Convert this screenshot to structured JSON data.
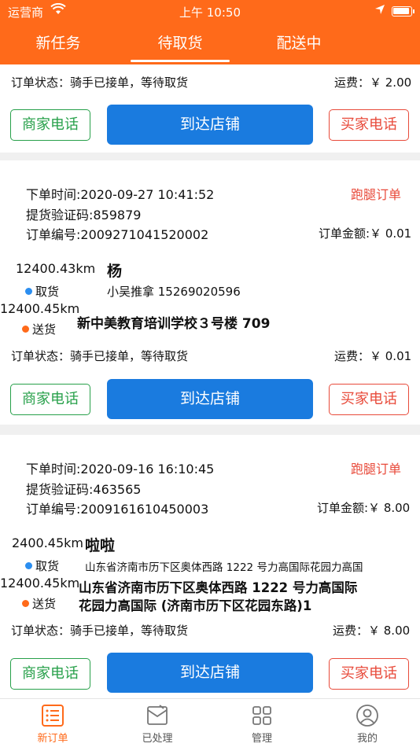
{
  "status_bar": {
    "carrier": "运营商",
    "time": "上午 10:50"
  },
  "tabs": [
    {
      "label": "新任务"
    },
    {
      "label": "待取货"
    },
    {
      "label": "配送中"
    }
  ],
  "top_card": {
    "status": "订单状态：骑手已接单，等待取货",
    "fee": "运费：￥ 2.00",
    "merchant_btn": "商家电话",
    "arrive_btn": "到达店铺",
    "buyer_btn": "买家电话"
  },
  "orders": [
    {
      "order_time": "下单时间:2020-09-27 10:41:52",
      "order_type": "跑腿订单",
      "pickup_code": "提货验证码:859879",
      "order_no": "订单编号:2009271041520002",
      "amount": "订单金额:￥ 0.01",
      "pickup_distance": "12400.43km",
      "customer_name": "杨",
      "pickup_label": "取货",
      "pickup_address": "小吴推拿 15269020596",
      "deliver_distance": "12400.45km",
      "deliver_label": "送货",
      "deliver_address": "新中美教育培训学校３号楼 709",
      "status": "订单状态：骑手已接单，等待取货",
      "fee": "运费：￥ 0.01",
      "merchant_btn": "商家电话",
      "arrive_btn": "到达店铺",
      "buyer_btn": "买家电话"
    },
    {
      "order_time": "下单时间:2020-09-16 16:10:45",
      "order_type": "跑腿订单",
      "pickup_code": "提货验证码:463565",
      "order_no": "订单编号:2009161610450003",
      "amount": "订单金额:￥ 8.00",
      "pickup_distance": "2400.45km",
      "customer_name": "啦啦",
      "pickup_label": "取货",
      "pickup_address": "山东省济南市历下区奥体西路 1222 号力高国际花园力高国",
      "deliver_distance": "12400.45km",
      "deliver_label": "送货",
      "deliver_address_line1": "山东省济南市历下区奥体西路 1222 号力高国际",
      "deliver_address_line2": "花园力高国际 (济南市历下区花园东路)1",
      "status": "订单状态：骑手已接单，等待取货",
      "fee": "运费：￥ 8.00",
      "merchant_btn": "商家电话",
      "arrive_btn": "到达店铺",
      "buyer_btn": "买家电话"
    }
  ],
  "bottom_nav": [
    {
      "label": "新订单",
      "icon": "list-icon"
    },
    {
      "label": "已处理",
      "icon": "processed-icon"
    },
    {
      "label": "管理",
      "icon": "grid-icon"
    },
    {
      "label": "我的",
      "icon": "user-icon"
    }
  ],
  "colors": {
    "brand": "#ff6a1a",
    "primary_button": "#1a7bdf",
    "merchant_green": "#27a04a",
    "buyer_red": "#e84a3a"
  }
}
